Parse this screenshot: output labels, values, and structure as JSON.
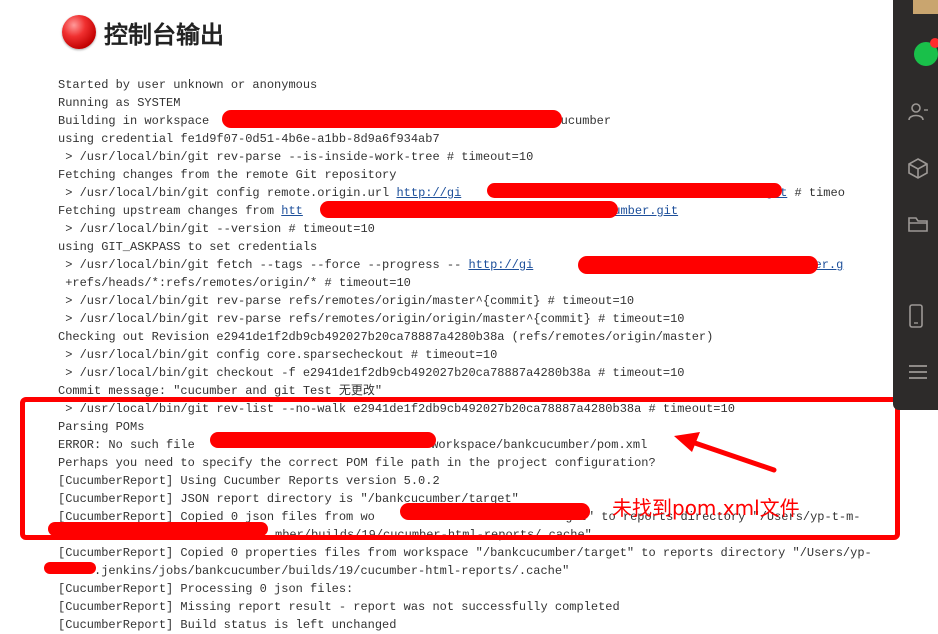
{
  "header": {
    "title": "控制台输出",
    "icon": "red-ball-icon"
  },
  "console": {
    "lines": [
      "Started by user unknown or anonymous",
      "Running as SYSTEM",
      "Building in workspace ",
      "using credential fe1d9f07-0d51-4b6e-a1bb-8d9a6f934ab7",
      " > /usr/local/bin/git rev-parse --is-inside-work-tree # timeout=10",
      "Fetching changes from the remote Git repository",
      " > /usr/local/bin/git config remote.origin.url ",
      "Fetching upstream changes from ",
      " > /usr/local/bin/git --version # timeout=10",
      "using GIT_ASKPASS to set credentials",
      " > /usr/local/bin/git fetch --tags --force --progress -- ",
      " +refs/heads/*:refs/remotes/origin/* # timeout=10",
      " > /usr/local/bin/git rev-parse refs/remotes/origin/master^{commit} # timeout=10",
      " > /usr/local/bin/git rev-parse refs/remotes/origin/origin/master^{commit} # timeout=10",
      "Checking out Revision e2941de1f2db9cb492027b20ca78887a4280b38a (refs/remotes/origin/master)",
      " > /usr/local/bin/git config core.sparsecheckout # timeout=10",
      " > /usr/local/bin/git checkout -f e2941de1f2db9cb492027b20ca78887a4280b38a # timeout=10",
      "Commit message: \"cucumber and git Test 无更改\"",
      " > /usr/local/bin/git rev-list --no-walk e2941de1f2db9cb492027b20ca78887a4280b38a # timeout=10",
      "Parsing POMs",
      "ERROR: No such file ",
      "Perhaps you need to specify the correct POM file path in the project configuration?",
      "[CucumberReport] Using Cucumber Reports version 5.0.2",
      "[CucumberReport] JSON report directory is \"/bankcucumber/target\"",
      "[CucumberReport] Copied 0 json files from wo",
      "",
      "[CucumberReport] Copied 0 properties files from workspace \"/bankcucumber/target\" to reports directory \"/Users/yp-",
      "",
      "[CucumberReport] Processing 0 json files:",
      "[CucumberReport] Missing report result - report was not successfully completed",
      "[CucumberReport] Build status is left unchanged"
    ],
    "line2_suffix": "cucumber",
    "line6_link_start": "http://gi",
    "line6_link_end": "r.git",
    "line6_suffix": " # timeo",
    "line7_link_start": "htt",
    "line7_link_end": "ucumber.git",
    "line10_link_start": "http://gi",
    "line10_link_end": "cucumber.g",
    "line20_suffix": "/workspace/bankcucumber/pom.xml",
    "line24_suffix": "arget\" to reports directory \"/Users/yp-t-m-",
    "line25_text": "mber/builds/19/cucumber-html-reports/.cache\"",
    "line27_text": ".jenkins/jobs/bankcucumber/builds/19/cucumber-html-reports/.cache\""
  },
  "annotation": {
    "text": "未找到pom.xml文件",
    "color": "#ff0000"
  },
  "sidebar": {
    "icons": [
      "contacts-icon",
      "cube-icon",
      "folder-icon",
      "phone-icon",
      "menu-icon"
    ]
  }
}
